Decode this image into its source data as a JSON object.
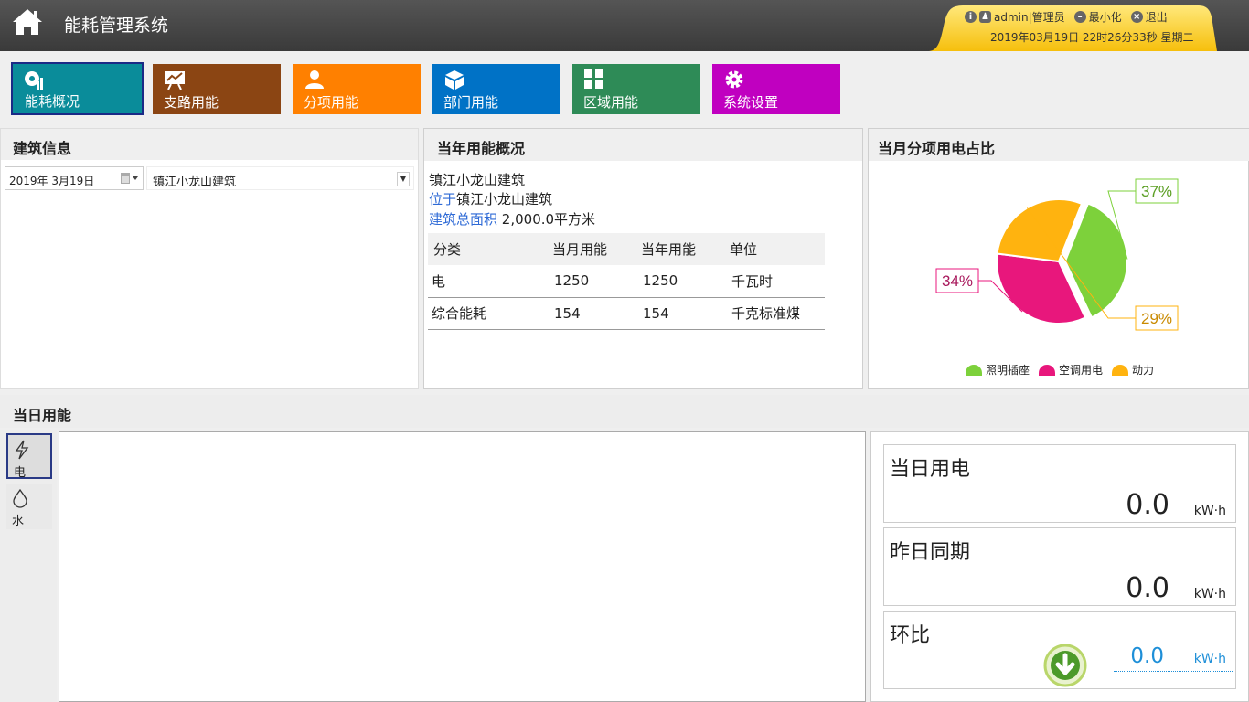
{
  "header": {
    "title": "能耗管理系统",
    "user": "admin|管理员",
    "minimize": "最小化",
    "logout": "退出",
    "datetime": "2019年03月19日 22时26分33秒 星期二"
  },
  "nav": [
    {
      "label": "能耗概况",
      "color": "#0a8c9a",
      "icon": "overview-icon"
    },
    {
      "label": "支路用能",
      "color": "#8b4513",
      "icon": "chart-board-icon"
    },
    {
      "label": "分项用能",
      "color": "#ff8000",
      "icon": "user-icon"
    },
    {
      "label": "部门用能",
      "color": "#0072c6",
      "icon": "cube-icon"
    },
    {
      "label": "区域用能",
      "color": "#2e8b57",
      "icon": "grid-icon"
    },
    {
      "label": "系统设置",
      "color": "#c000c0",
      "icon": "gear-icon"
    }
  ],
  "building_info": {
    "title": "建筑信息",
    "date": "2019年  3月19日",
    "building": "镇江小龙山建筑"
  },
  "yearly": {
    "title": "当年用能概况",
    "name": "镇江小龙山建筑",
    "location_label": "位于",
    "location": "镇江小龙山建筑",
    "area_label": "建筑总面积",
    "area": "2,000.0平方米",
    "headers": [
      "分类",
      "当月用能",
      "当年用能",
      "单位"
    ],
    "rows": [
      [
        "电",
        "1250",
        "1250",
        "千瓦时"
      ],
      [
        "综合能耗",
        "154",
        "154",
        "千克标准煤"
      ]
    ]
  },
  "pie": {
    "title": "当月分项用电占比",
    "chart_data": {
      "type": "pie",
      "labels": [
        "照明插座",
        "空调用电",
        "动力"
      ],
      "values": [
        37,
        34,
        29
      ],
      "colors": [
        "#7dd13b",
        "#e8177c",
        "#ffb30f"
      ],
      "label_texts": [
        "37%",
        "34%",
        "29%"
      ]
    }
  },
  "daily": {
    "title": "当日用能",
    "types": [
      {
        "label": "电",
        "icon": "lightning-icon"
      },
      {
        "label": "水",
        "icon": "water-drop-icon"
      }
    ],
    "cards": [
      {
        "label": "当日用电",
        "value": "0.0",
        "unit": "kW·h"
      },
      {
        "label": "昨日同期",
        "value": "0.0",
        "unit": "kW·h"
      },
      {
        "label": "环比",
        "value": "0.0",
        "unit": "kW·h"
      }
    ]
  }
}
